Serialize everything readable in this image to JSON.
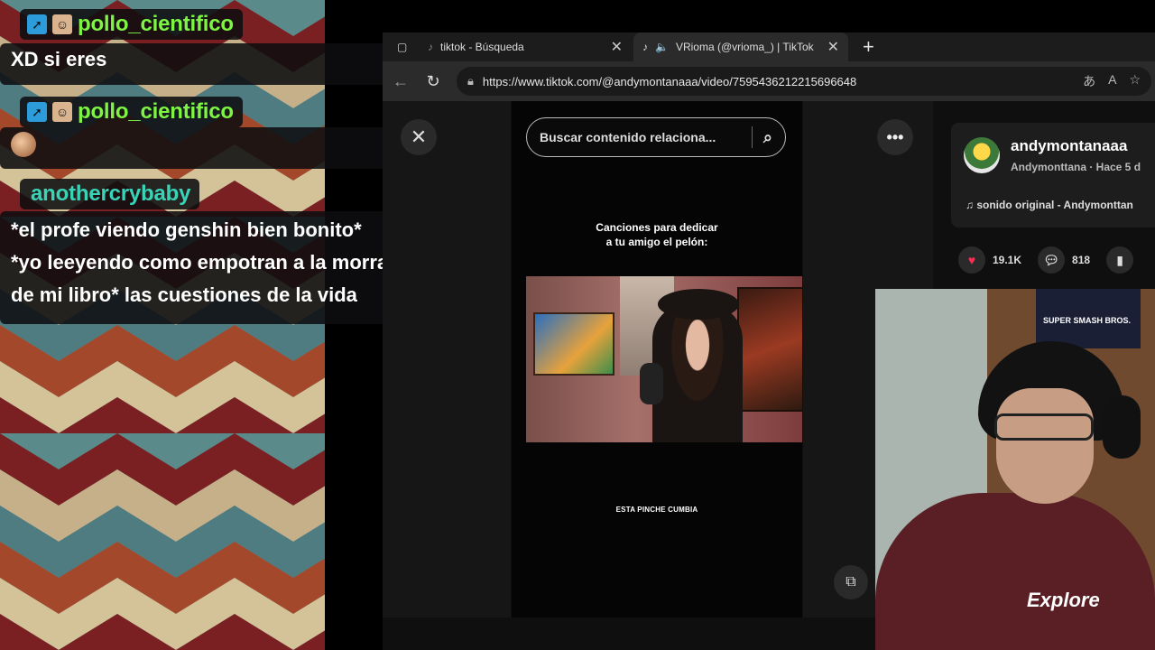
{
  "chat": {
    "messages": [
      {
        "user": "pollo_cientifico",
        "text": "XD si eres"
      },
      {
        "user": "pollo_cientifico",
        "emote": "face-emote"
      },
      {
        "user": "anothercrybaby",
        "lines": [
          "*el profe viendo genshin bien bonito*",
          "*yo leeyendo como empotran a la morra",
          "de mi libro* las cuestiones de la vida"
        ]
      }
    ]
  },
  "browser": {
    "tabs": [
      {
        "label": "tiktok - Búsqueda"
      },
      {
        "label": "VRioma (@vrioma_) | TikTok"
      }
    ],
    "url": "https://www.tiktok.com/@andymontanaaa/video/7595436212215696648"
  },
  "tiktok": {
    "search_placeholder": "Buscar contenido relaciona...",
    "caption_line1": "Canciones para dedicar",
    "caption_line2": "a tu amigo el pelón:",
    "clip_text": "ESTA PINCHE CUMBIA",
    "author": {
      "handle": "andymontanaaa",
      "subtitle": "Andymonttana · Hace 5 d",
      "sound": "sonido original - Andymonttan"
    },
    "stats": {
      "likes": "19.1K",
      "comments": "818"
    }
  },
  "webcam": {
    "poster_text": "SUPER SMASH BROS.",
    "shirt_logo": "Explore"
  },
  "colors": {
    "user_green": "#7df542",
    "user_teal": "#39d4b8",
    "like_red": "#fe2c55"
  }
}
